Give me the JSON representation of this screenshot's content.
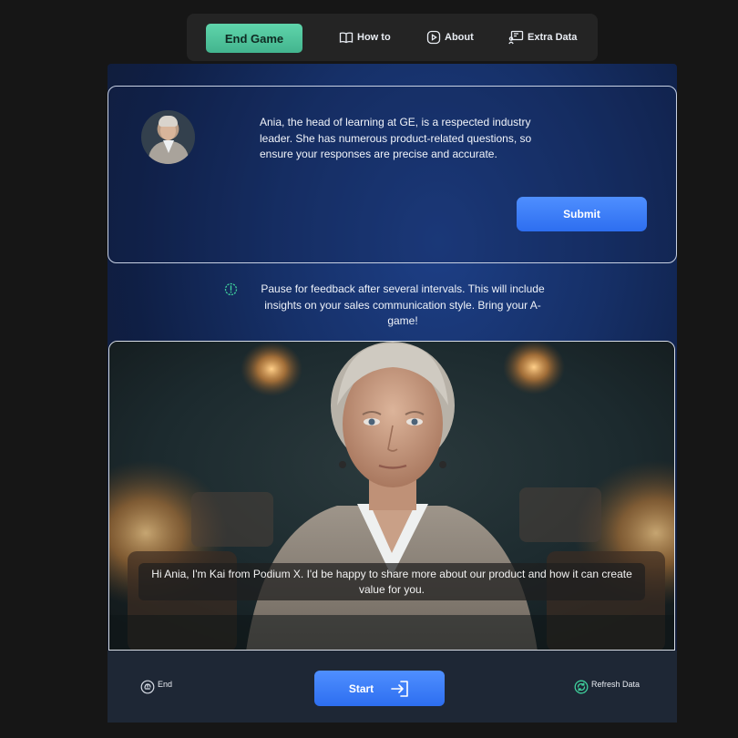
{
  "nav": {
    "end_game": "End Game",
    "how_to": "How to",
    "about": "About",
    "extra_data": "Extra Data"
  },
  "info_card": {
    "description": "Ania, the head of learning at GE, is a respected industry leader. She has numerous product-related questions, so ensure your responses are precise and accurate.",
    "submit": "Submit"
  },
  "notice": {
    "text": "Pause for feedback after several intervals. This will include insights on your sales communication style. Bring your A-game!"
  },
  "video": {
    "caption": "Hi Ania, I'm Kai from Podium X. I'd be happy to share more about our product and how it can create value for you."
  },
  "controls": {
    "end": "End",
    "start": "Start",
    "refresh": "Refresh Data"
  },
  "colors": {
    "accent_green": "#4cc59b",
    "accent_blue": "#3a7ef7",
    "background": "#161616"
  }
}
